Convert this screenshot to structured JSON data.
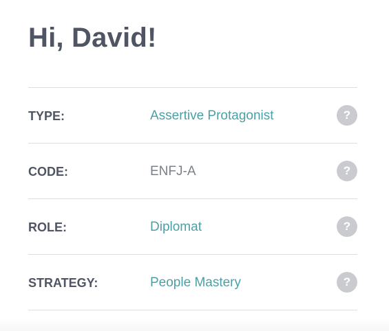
{
  "greeting": "Hi, David!",
  "rows": [
    {
      "label": "TYPE:",
      "value": "Assertive Protagonist",
      "value_style": "link",
      "help_icon": "?"
    },
    {
      "label": "CODE:",
      "value": "ENFJ-A",
      "value_style": "plain",
      "help_icon": "?"
    },
    {
      "label": "ROLE:",
      "value": "Diplomat",
      "value_style": "link",
      "help_icon": "?"
    },
    {
      "label": "STRATEGY:",
      "value": "People Mastery",
      "value_style": "link",
      "help_icon": "?"
    }
  ],
  "colors": {
    "heading": "#4f5563",
    "link": "#4aa0a6",
    "plain_value": "#7b7f87",
    "divider": "#dddee2",
    "help_icon_bg": "#c9cbcf"
  }
}
